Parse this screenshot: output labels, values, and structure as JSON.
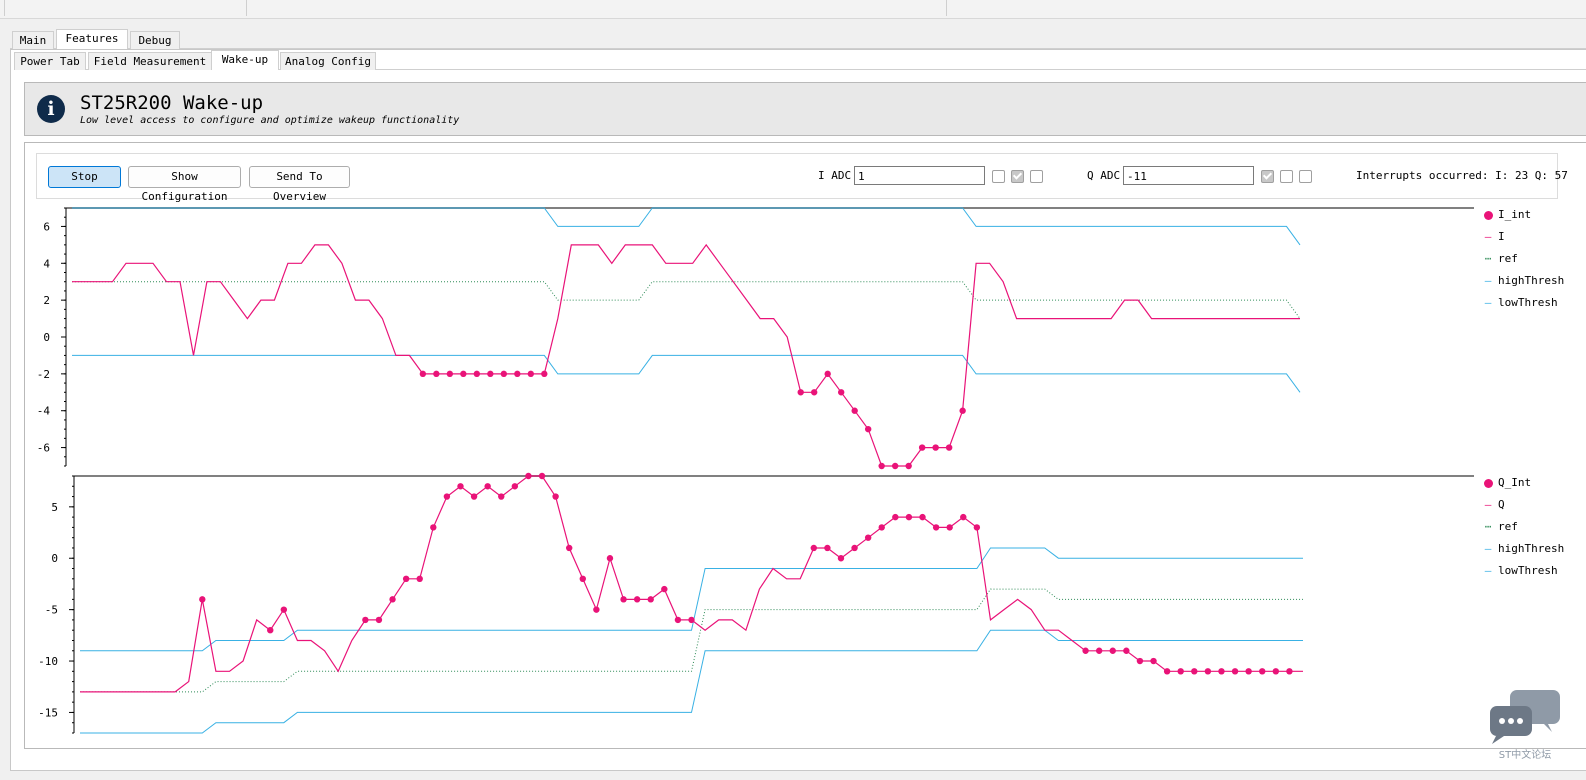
{
  "tabs_top": [
    "Main",
    "Features",
    "Debug"
  ],
  "tabs_top_active": 1,
  "tabs_sub": [
    "Power Tab",
    "Field Measurement",
    "Wake-up",
    "Analog Config"
  ],
  "tabs_sub_active": 2,
  "header": {
    "title": "ST25R200 Wake-up",
    "subtitle": "Low level access to configure and optimize wakeup functionality",
    "icon": "info-icon"
  },
  "controls": {
    "stop_label": "Stop",
    "show_config_label": "Show Configuration",
    "send_overview_label": "Send To Overview",
    "i_adc_label": "I ADC",
    "i_adc_value": "1",
    "q_adc_label": "Q ADC",
    "q_adc_value": "-11",
    "i_checks": [
      false,
      true,
      false
    ],
    "q_checks": [
      true,
      false,
      false
    ],
    "interrupts_text": "Interrupts occurred: I: 23 Q: 57"
  },
  "colors": {
    "signal": "#e91378",
    "thresh": "#39b1e4",
    "ref": "#2e8b57"
  },
  "watermark_text": "ST中文论坛",
  "chart_data": [
    {
      "type": "line",
      "ylim": [
        -7,
        7
      ],
      "yticks": [
        6,
        4,
        2,
        0,
        -2,
        -4,
        -6
      ],
      "legend": [
        {
          "name": "I_int",
          "style": "marker"
        },
        {
          "name": "I",
          "style": "line"
        },
        {
          "name": "ref",
          "style": "dotted"
        },
        {
          "name": "highThresh",
          "style": "line"
        },
        {
          "name": "lowThresh",
          "style": "line"
        }
      ],
      "I": [
        3,
        3,
        3,
        3,
        4,
        4,
        4,
        3,
        3,
        -1,
        3,
        3,
        2,
        1,
        2,
        2,
        4,
        4,
        5,
        5,
        4,
        2,
        2,
        1,
        -1,
        -1,
        -2,
        -2,
        -2,
        -2,
        -2,
        -2,
        -2,
        -2,
        -2,
        -2,
        1,
        5,
        5,
        5,
        4,
        5,
        5,
        5,
        4,
        4,
        4,
        5,
        4,
        3,
        2,
        1,
        1,
        0,
        -3,
        -3,
        -2,
        -3,
        -4,
        -5,
        -7,
        -7,
        -7,
        -6,
        -6,
        -6,
        -4,
        4,
        4,
        3,
        1,
        1,
        1,
        1,
        1,
        1,
        1,
        1,
        2,
        2,
        1,
        1,
        1,
        1,
        1,
        1,
        1,
        1,
        1,
        1,
        1,
        1
      ],
      "I_int_indices": [
        26,
        27,
        28,
        29,
        30,
        31,
        32,
        33,
        34,
        35,
        54,
        55,
        56,
        57,
        58,
        59,
        60,
        61,
        62,
        63,
        64,
        65,
        66
      ],
      "ref": [
        3,
        3,
        3,
        3,
        3,
        3,
        3,
        3,
        3,
        3,
        3,
        3,
        3,
        3,
        3,
        3,
        3,
        3,
        3,
        3,
        3,
        3,
        3,
        3,
        3,
        3,
        3,
        3,
        3,
        3,
        3,
        3,
        3,
        3,
        3,
        3,
        2,
        2,
        2,
        2,
        2,
        2,
        2,
        3,
        3,
        3,
        3,
        3,
        3,
        3,
        3,
        3,
        3,
        3,
        3,
        3,
        3,
        3,
        3,
        3,
        3,
        3,
        3,
        3,
        3,
        3,
        3,
        2,
        2,
        2,
        2,
        2,
        2,
        2,
        2,
        2,
        2,
        2,
        2,
        2,
        2,
        2,
        2,
        2,
        2,
        2,
        2,
        2,
        2,
        2,
        2,
        1
      ],
      "highThresh": [
        7,
        7,
        7,
        7,
        7,
        7,
        7,
        7,
        7,
        7,
        7,
        7,
        7,
        7,
        7,
        7,
        7,
        7,
        7,
        7,
        7,
        7,
        7,
        7,
        7,
        7,
        7,
        7,
        7,
        7,
        7,
        7,
        7,
        7,
        7,
        7,
        6,
        6,
        6,
        6,
        6,
        6,
        6,
        7,
        7,
        7,
        7,
        7,
        7,
        7,
        7,
        7,
        7,
        7,
        7,
        7,
        7,
        7,
        7,
        7,
        7,
        7,
        7,
        7,
        7,
        7,
        7,
        6,
        6,
        6,
        6,
        6,
        6,
        6,
        6,
        6,
        6,
        6,
        6,
        6,
        6,
        6,
        6,
        6,
        6,
        6,
        6,
        6,
        6,
        6,
        6,
        5
      ],
      "lowThresh": [
        -1,
        -1,
        -1,
        -1,
        -1,
        -1,
        -1,
        -1,
        -1,
        -1,
        -1,
        -1,
        -1,
        -1,
        -1,
        -1,
        -1,
        -1,
        -1,
        -1,
        -1,
        -1,
        -1,
        -1,
        -1,
        -1,
        -1,
        -1,
        -1,
        -1,
        -1,
        -1,
        -1,
        -1,
        -1,
        -1,
        -2,
        -2,
        -2,
        -2,
        -2,
        -2,
        -2,
        -1,
        -1,
        -1,
        -1,
        -1,
        -1,
        -1,
        -1,
        -1,
        -1,
        -1,
        -1,
        -1,
        -1,
        -1,
        -1,
        -1,
        -1,
        -1,
        -1,
        -1,
        -1,
        -1,
        -1,
        -2,
        -2,
        -2,
        -2,
        -2,
        -2,
        -2,
        -2,
        -2,
        -2,
        -2,
        -2,
        -2,
        -2,
        -2,
        -2,
        -2,
        -2,
        -2,
        -2,
        -2,
        -2,
        -2,
        -2,
        -3
      ]
    },
    {
      "type": "line",
      "ylim": [
        -17,
        8
      ],
      "yticks": [
        5,
        0,
        -5,
        -10,
        -15
      ],
      "legend": [
        {
          "name": "Q_Int",
          "style": "marker"
        },
        {
          "name": "Q",
          "style": "line"
        },
        {
          "name": "ref",
          "style": "dotted"
        },
        {
          "name": "highThresh",
          "style": "line"
        },
        {
          "name": "lowThresh",
          "style": "line"
        }
      ],
      "Q": [
        -13,
        -13,
        -13,
        -13,
        -13,
        -13,
        -13,
        -13,
        -12,
        -4,
        -11,
        -11,
        -10,
        -6,
        -7,
        -5,
        -8,
        -8,
        -9,
        -11,
        -8,
        -6,
        -6,
        -4,
        -2,
        -2,
        3,
        6,
        7,
        6,
        7,
        6,
        7,
        8,
        8,
        6,
        1,
        -2,
        -5,
        0,
        -4,
        -4,
        -4,
        -3,
        -6,
        -6,
        -7,
        -6,
        -6,
        -7,
        -3,
        -1,
        -2,
        -2,
        1,
        1,
        0,
        1,
        2,
        3,
        4,
        4,
        4,
        3,
        3,
        4,
        3,
        -6,
        -5,
        -4,
        -5,
        -7,
        -7,
        -8,
        -9,
        -9,
        -9,
        -9,
        -10,
        -10,
        -11,
        -11,
        -11,
        -11,
        -11,
        -11,
        -11,
        -11,
        -11,
        -11,
        -11
      ],
      "Q_Int_indices": [
        9,
        14,
        15,
        21,
        22,
        23,
        24,
        25,
        26,
        27,
        28,
        29,
        30,
        31,
        32,
        33,
        34,
        35,
        36,
        37,
        38,
        39,
        40,
        41,
        42,
        43,
        44,
        45,
        54,
        55,
        56,
        57,
        58,
        59,
        60,
        61,
        62,
        63,
        64,
        65,
        66,
        74,
        75,
        76,
        77,
        78,
        79,
        80,
        81,
        82,
        83,
        84,
        85,
        86,
        87,
        88,
        89
      ],
      "ref": [
        -13,
        -13,
        -13,
        -13,
        -13,
        -13,
        -13,
        -13,
        -13,
        -13,
        -12,
        -12,
        -12,
        -12,
        -12,
        -12,
        -11,
        -11,
        -11,
        -11,
        -11,
        -11,
        -11,
        -11,
        -11,
        -11,
        -11,
        -11,
        -11,
        -11,
        -11,
        -11,
        -11,
        -11,
        -11,
        -11,
        -11,
        -11,
        -11,
        -11,
        -11,
        -11,
        -11,
        -11,
        -11,
        -11,
        -5,
        -5,
        -5,
        -5,
        -5,
        -5,
        -5,
        -5,
        -5,
        -5,
        -5,
        -5,
        -5,
        -5,
        -5,
        -5,
        -5,
        -5,
        -5,
        -5,
        -5,
        -3,
        -3,
        -3,
        -3,
        -3,
        -4,
        -4,
        -4,
        -4,
        -4,
        -4,
        -4,
        -4,
        -4,
        -4,
        -4,
        -4,
        -4,
        -4,
        -4,
        -4,
        -4,
        -4,
        -4
      ],
      "highThresh": [
        -9,
        -9,
        -9,
        -9,
        -9,
        -9,
        -9,
        -9,
        -9,
        -9,
        -8,
        -8,
        -8,
        -8,
        -8,
        -8,
        -7,
        -7,
        -7,
        -7,
        -7,
        -7,
        -7,
        -7,
        -7,
        -7,
        -7,
        -7,
        -7,
        -7,
        -7,
        -7,
        -7,
        -7,
        -7,
        -7,
        -7,
        -7,
        -7,
        -7,
        -7,
        -7,
        -7,
        -7,
        -7,
        -7,
        -1,
        -1,
        -1,
        -1,
        -1,
        -1,
        -1,
        -1,
        -1,
        -1,
        -1,
        -1,
        -1,
        -1,
        -1,
        -1,
        -1,
        -1,
        -1,
        -1,
        -1,
        1,
        1,
        1,
        1,
        1,
        0,
        0,
        0,
        0,
        0,
        0,
        0,
        0,
        0,
        0,
        0,
        0,
        0,
        0,
        0,
        0,
        0,
        0,
        0
      ],
      "lowThresh": [
        -17,
        -17,
        -17,
        -17,
        -17,
        -17,
        -17,
        -17,
        -17,
        -17,
        -16,
        -16,
        -16,
        -16,
        -16,
        -16,
        -15,
        -15,
        -15,
        -15,
        -15,
        -15,
        -15,
        -15,
        -15,
        -15,
        -15,
        -15,
        -15,
        -15,
        -15,
        -15,
        -15,
        -15,
        -15,
        -15,
        -15,
        -15,
        -15,
        -15,
        -15,
        -15,
        -15,
        -15,
        -15,
        -15,
        -9,
        -9,
        -9,
        -9,
        -9,
        -9,
        -9,
        -9,
        -9,
        -9,
        -9,
        -9,
        -9,
        -9,
        -9,
        -9,
        -9,
        -9,
        -9,
        -9,
        -9,
        -7,
        -7,
        -7,
        -7,
        -7,
        -8,
        -8,
        -8,
        -8,
        -8,
        -8,
        -8,
        -8,
        -8,
        -8,
        -8,
        -8,
        -8,
        -8,
        -8,
        -8,
        -8,
        -8,
        -8
      ]
    }
  ]
}
